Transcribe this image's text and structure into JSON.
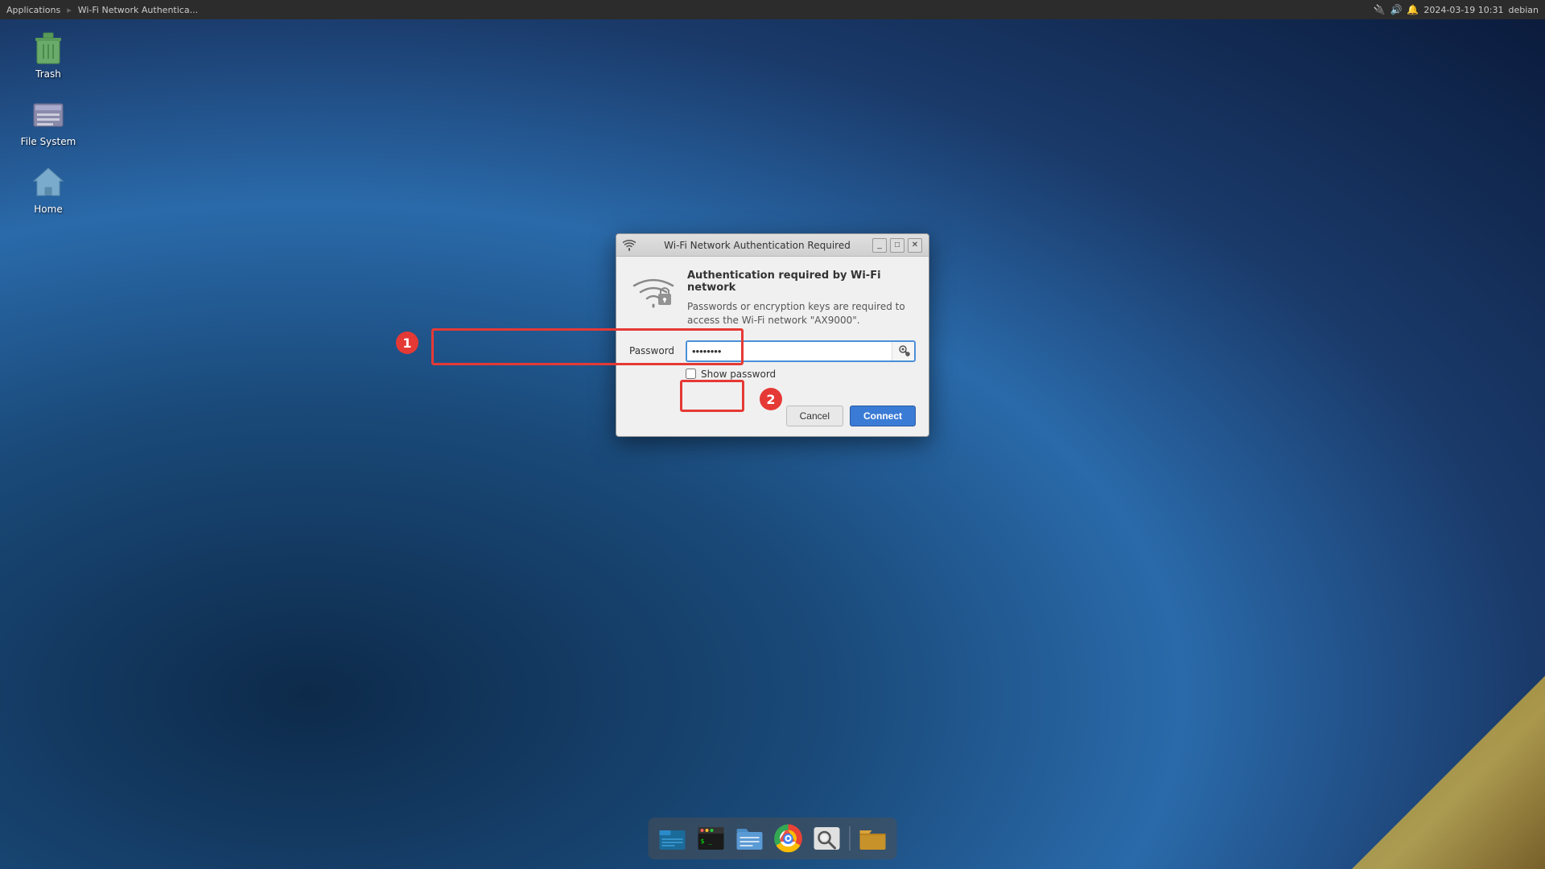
{
  "taskbar": {
    "apps_label": "Applications",
    "window_title": "Wi-Fi Network Authentica...",
    "datetime": "2024-03-19 10:31",
    "os_label": "debian"
  },
  "desktop": {
    "icons": [
      {
        "id": "trash",
        "label": "Trash",
        "emoji": "🗑"
      },
      {
        "id": "filesystem",
        "label": "File System",
        "emoji": "🖴"
      },
      {
        "id": "home",
        "label": "Home",
        "emoji": "🏠"
      }
    ]
  },
  "dialog": {
    "title": "Wi-Fi Network Authentication Required",
    "heading": "Authentication required by Wi-Fi network",
    "description": "Passwords or encryption keys are required to access the Wi-Fi network \"AX9000\".",
    "password_label": "Password",
    "password_value": "••••••••",
    "show_password_label": "Show password",
    "cancel_label": "Cancel",
    "connect_label": "Connect"
  },
  "annotations": {
    "badge1_label": "1",
    "badge2_label": "2"
  },
  "dock": {
    "items": [
      {
        "id": "file-manager",
        "label": "File Manager",
        "color": "#1a6b9a"
      },
      {
        "id": "terminal",
        "label": "Terminal",
        "color": "#2c2c2c"
      },
      {
        "id": "files",
        "label": "Files",
        "color": "#4a90d9"
      },
      {
        "id": "chrome",
        "label": "Chrome",
        "color": "#fff"
      },
      {
        "id": "search",
        "label": "Search",
        "color": "#e8e8e8"
      },
      {
        "id": "folder",
        "label": "Folder",
        "color": "#8a6a2a"
      }
    ]
  }
}
